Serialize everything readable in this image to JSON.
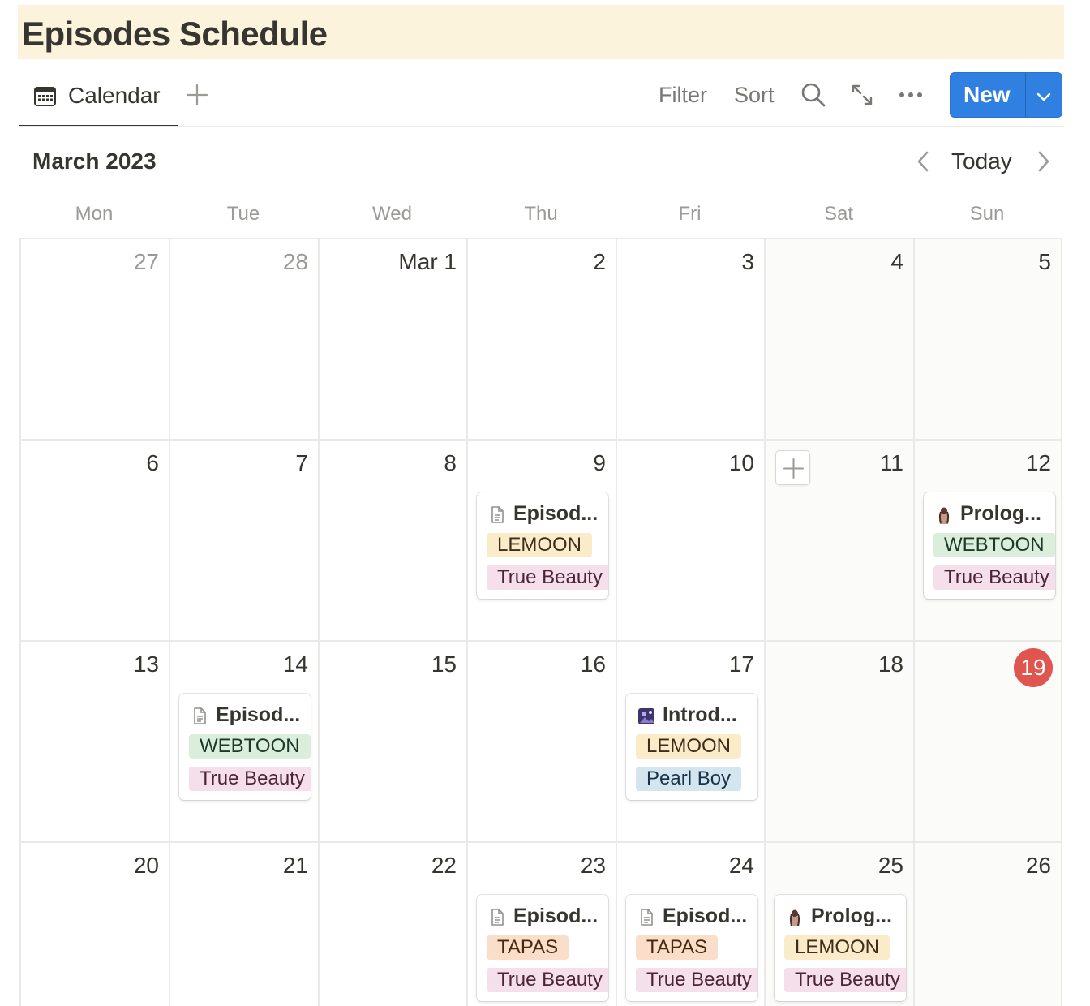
{
  "page": {
    "title": "Episodes Schedule"
  },
  "view": {
    "tab_label": "Calendar",
    "toolbar": {
      "filter_label": "Filter",
      "sort_label": "Sort",
      "new_label": "New"
    }
  },
  "calendar": {
    "month_label": "March 2023",
    "today_label": "Today",
    "weekdays": [
      "Mon",
      "Tue",
      "Wed",
      "Thu",
      "Fri",
      "Sat",
      "Sun"
    ],
    "days": [
      {
        "label": "27",
        "muted": true
      },
      {
        "label": "28",
        "muted": true
      },
      {
        "label": "Mar 1"
      },
      {
        "label": "2"
      },
      {
        "label": "3"
      },
      {
        "label": "4"
      },
      {
        "label": "5"
      },
      {
        "label": "6"
      },
      {
        "label": "7"
      },
      {
        "label": "8"
      },
      {
        "label": "9"
      },
      {
        "label": "10"
      },
      {
        "label": "11"
      },
      {
        "label": "12"
      },
      {
        "label": "13"
      },
      {
        "label": "14"
      },
      {
        "label": "15"
      },
      {
        "label": "16"
      },
      {
        "label": "17"
      },
      {
        "label": "18"
      },
      {
        "label": "19",
        "today": true
      },
      {
        "label": "20"
      },
      {
        "label": "21"
      },
      {
        "label": "22"
      },
      {
        "label": "23"
      },
      {
        "label": "24"
      },
      {
        "label": "25"
      },
      {
        "label": "26"
      }
    ],
    "events": [
      {
        "day": "9",
        "icon": "document-icon",
        "title": "Episod...",
        "tags": [
          {
            "text": "LEMOON",
            "color": "lemoon"
          },
          {
            "text": "True Beauty",
            "color": "truebeauty"
          }
        ]
      },
      {
        "day": "12",
        "icon": "character-avatar-icon",
        "title": "Prolog...",
        "tags": [
          {
            "text": "WEBTOON",
            "color": "webtoon"
          },
          {
            "text": "True Beauty",
            "color": "truebeauty"
          }
        ]
      },
      {
        "day": "14",
        "icon": "document-icon",
        "title": "Episod...",
        "tags": [
          {
            "text": "WEBTOON",
            "color": "webtoon"
          },
          {
            "text": "True Beauty",
            "color": "truebeauty"
          }
        ]
      },
      {
        "day": "17",
        "icon": "cover-image-icon",
        "title": "Introd...",
        "tags": [
          {
            "text": "LEMOON",
            "color": "lemoon"
          },
          {
            "text": "Pearl Boy",
            "color": "pearlboy"
          }
        ]
      },
      {
        "day": "23",
        "icon": "document-icon",
        "title": "Episod...",
        "tags": [
          {
            "text": "TAPAS",
            "color": "tapas"
          },
          {
            "text": "True Beauty",
            "color": "truebeauty"
          }
        ]
      },
      {
        "day": "24",
        "icon": "document-icon",
        "title": "Episod...",
        "tags": [
          {
            "text": "TAPAS",
            "color": "tapas"
          },
          {
            "text": "True Beauty",
            "color": "truebeauty"
          }
        ]
      },
      {
        "day": "25",
        "icon": "character-avatar-icon",
        "title": "Prolog...",
        "tags": [
          {
            "text": "LEMOON",
            "color": "lemoon"
          },
          {
            "text": "True Beauty",
            "color": "truebeauty"
          }
        ]
      }
    ]
  },
  "colors": {
    "title_bg": "#fbf3db",
    "accent": "#2f80e1",
    "today_badge": "#e0554e",
    "tag_lemoon": "#fbecc9",
    "tag_webtoon": "#dbeddb",
    "tag_tapas": "#fadec9",
    "tag_truebeauty": "#f4dfeb",
    "tag_pearlboy": "#d3e5ef"
  }
}
